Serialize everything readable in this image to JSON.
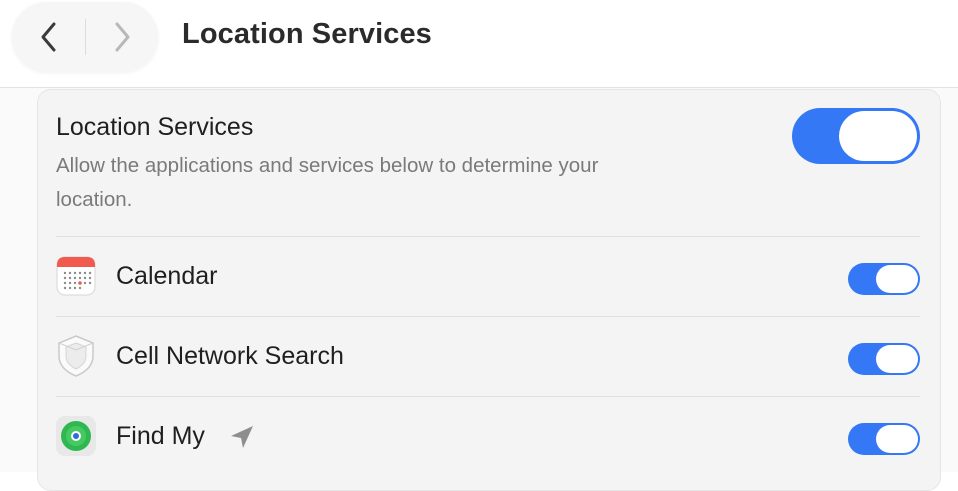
{
  "header": {
    "title": "Location Services"
  },
  "location_services": {
    "title": "Location Services",
    "description": "Allow the applications and services below to determine your location.",
    "enabled": true
  },
  "apps": [
    {
      "name": "Calendar",
      "icon": "calendar-icon",
      "enabled": true
    },
    {
      "name": "Cell Network Search",
      "icon": "shield-icon",
      "enabled": true
    },
    {
      "name": "Find My",
      "icon": "find-my-icon",
      "enabled": true,
      "indicator": "location-arrow-icon"
    }
  ],
  "colors": {
    "accent": "#3478f6",
    "card_background": "#f4f4f4"
  }
}
